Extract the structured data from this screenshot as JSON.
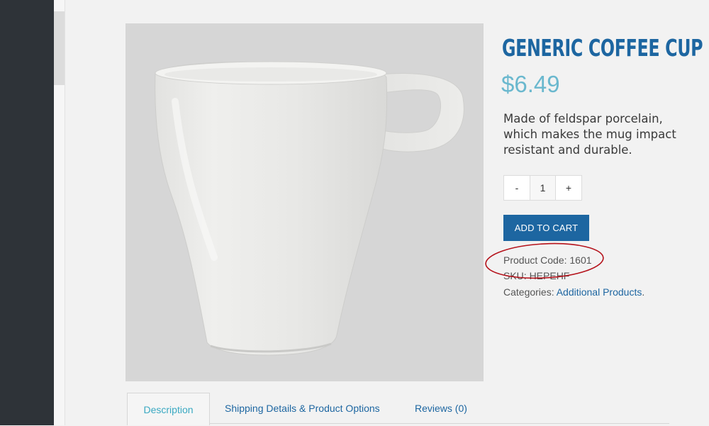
{
  "product": {
    "title": "Generic Coffee Cup",
    "price": "$6.49",
    "description": "Made of feldspar porcelain, which makes the mug impact resistant and durable.",
    "quantity": {
      "minus_label": "-",
      "value": "1",
      "plus_label": "+"
    },
    "add_to_cart_label": "ADD TO CART",
    "product_code": "Product Code: 1601",
    "sku": "SKU: HEPEHF",
    "categories_label": "Categories:",
    "category_link": "Additional Products",
    "categories_suffix": "."
  },
  "tabs": [
    {
      "label": "Description",
      "active": true
    },
    {
      "label": "Shipping Details & Product Options",
      "active": false
    },
    {
      "label": "Reviews (0)",
      "active": false
    }
  ],
  "colors": {
    "brand_blue": "#1d66a1",
    "price_teal": "#6ab8ce",
    "annotation_red": "#b5121b",
    "sidebar_dark": "#2e3338"
  }
}
